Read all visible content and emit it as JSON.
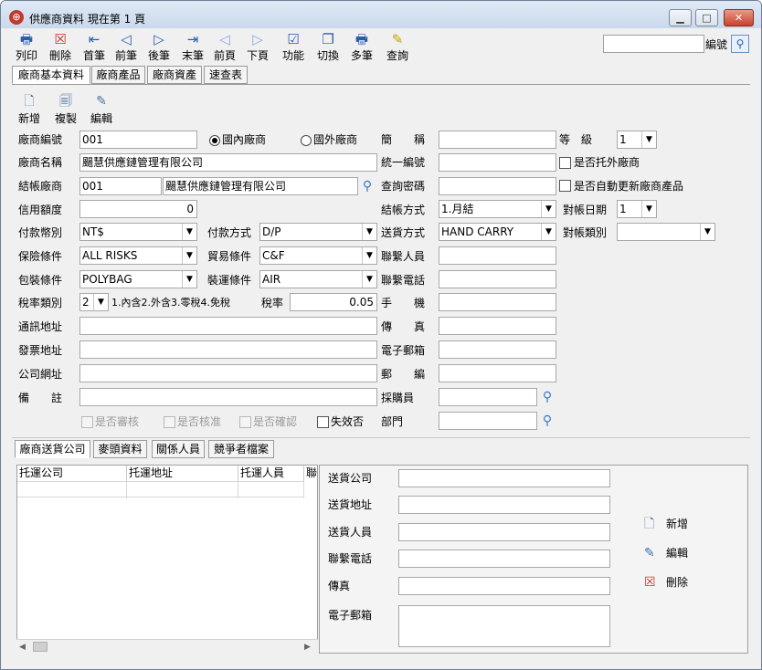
{
  "window": {
    "title": "供應商資料  現在第 1 頁",
    "minimize": "▁",
    "maximize": "□",
    "close": "✕"
  },
  "toolbar": {
    "print": "列印",
    "delete": "刪除",
    "first": "首筆",
    "prev": "前筆",
    "next": "後筆",
    "last": "末筆",
    "prev_page": "前頁",
    "next_page": "下頁",
    "function": "功能",
    "switch": "切換",
    "multi": "多筆",
    "query": "查詢",
    "search_label": "編號",
    "search_value": ""
  },
  "main_tabs": [
    "廠商基本資料",
    "廠商產品",
    "廠商資產",
    "速查表"
  ],
  "sub_toolbar": {
    "add": "新增",
    "copy": "複製",
    "edit": "編輯"
  },
  "form": {
    "vendor_no_label": "廠商編號",
    "vendor_no": "001",
    "domestic_label": "國內廠商",
    "foreign_label": "國外廠商",
    "short_name_label": "簡　　稱",
    "short_name": "",
    "grade_label": "等　級",
    "grade": "1",
    "vendor_name_label": "廠商名稱",
    "vendor_name": "颺慧供應鏈管理有限公司",
    "tax_id_label": "統一編號",
    "tax_id": "",
    "outsource_label": "是否托外廠商",
    "settle_vendor_label": "結帳廠商",
    "settle_vendor_no": "001",
    "settle_vendor_name": "颺慧供應鏈管理有限公司",
    "query_pwd_label": "查詢密碼",
    "query_pwd": "",
    "auto_update_label": "是否自動更新廠商產品",
    "credit_label": "信用額度",
    "credit": "0",
    "settle_method_label": "結帳方式",
    "settle_method": "1.月結",
    "reconcile_day_label": "對帳日期",
    "reconcile_day": "1",
    "currency_label": "付款幣別",
    "currency": "NT$",
    "pay_method_label": "付款方式",
    "pay_method": "D/P",
    "delivery_method_label": "送貨方式",
    "delivery_method": "HAND CARRY",
    "reconcile_type_label": "對帳類別",
    "reconcile_type": "",
    "insurance_label": "保險條件",
    "insurance": "ALL RISKS",
    "trade_label": "貿易條件",
    "trade": "C&F",
    "contact_label": "聯繫人員",
    "contact": "",
    "packing_label": "包裝條件",
    "packing": "POLYBAG",
    "shipping_label": "裝運條件",
    "shipping": "AIR",
    "contact_phone_label": "聯繫電話",
    "contact_phone": "",
    "tax_type_label": "稅率類別",
    "tax_type": "2",
    "tax_type_hint": "1.內含2.外含3.零稅4.免稅",
    "tax_rate_label": "稅率",
    "tax_rate": "0.05",
    "mobile_label": "手　　機",
    "mobile": "",
    "comm_addr_label": "通訊地址",
    "comm_addr": "",
    "fax_label": "傳　　真",
    "fax": "",
    "invoice_addr_label": "發票地址",
    "invoice_addr": "",
    "email_label": "電子郵箱",
    "email": "",
    "website_label": "公司網址",
    "website": "",
    "zip_label": "郵　　編",
    "zip": "",
    "note_label": "備　　註",
    "note": "",
    "buyer_label": "採購員",
    "buyer": "",
    "reviewed_label": "是否審核",
    "approved_label": "是否核准",
    "confirmed_label": "是否確認",
    "invalid_label": "失效否",
    "dept_label": "部門",
    "dept": ""
  },
  "bottom_tabs": [
    "廠商送貨公司",
    "麥頭資料",
    "關係人員",
    "競爭者檔案"
  ],
  "grid": {
    "columns": [
      "托運公司",
      "托運地址",
      "托運人員",
      "聯"
    ]
  },
  "detail": {
    "company_label": "送貨公司",
    "address_label": "送貨地址",
    "person_label": "送貨人員",
    "phone_label": "聯繫電話",
    "fax_label": "傳真",
    "email_label": "電子郵箱",
    "add": "新增",
    "edit": "編輯",
    "delete": "刪除"
  }
}
